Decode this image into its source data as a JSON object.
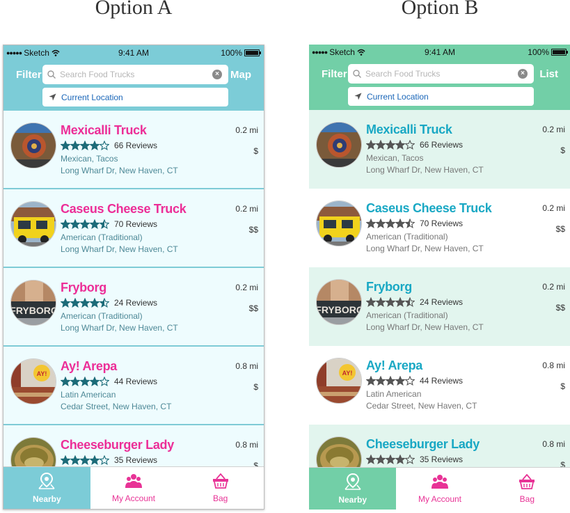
{
  "titles": {
    "a": "Option A",
    "b": "Option B"
  },
  "colors": {
    "a_header": "#7cccd7",
    "a_row_bg": "#eefcfe",
    "a_name": "#ec2e97",
    "a_stars": "#1c6b78",
    "a_subtext": "#4d8896",
    "b_header": "#72cfa7",
    "b_row_bg": "#e2f5ee",
    "b_name": "#19a8c4",
    "b_stars": "#555555",
    "b_subtext": "#777777",
    "tab_accent": "#e83396"
  },
  "status_bar": {
    "carrier": "Sketch",
    "time": "9:41 AM",
    "battery": "100%"
  },
  "header": {
    "filter_label": "Filter",
    "a_right_label": "Map",
    "b_right_label": "List",
    "search_placeholder": "Search Food Trucks",
    "location_label": "Current Location"
  },
  "restaurants": [
    {
      "name": "Mexicalli Truck",
      "stars": 4,
      "reviews": "66 Reviews",
      "category": "Mexican, Tacos",
      "address": "Long Wharf Dr, New Haven, CT",
      "distance": "0.2 mi",
      "price": "$",
      "thumb": "mural"
    },
    {
      "name": "Caseus Cheese Truck",
      "stars": 4.5,
      "reviews": "70 Reviews",
      "category": "American (Traditional)",
      "address": "Long Wharf Dr, New Haven, CT",
      "distance": "0.2 mi",
      "price": "$$",
      "thumb": "yellow-truck"
    },
    {
      "name": "Fryborg",
      "stars": 4.5,
      "reviews": "24 Reviews",
      "category": "American (Traditional)",
      "address": "Long Wharf Dr, New Haven, CT",
      "distance": "0.2 mi",
      "price": "$$",
      "thumb": "fryborg-sign"
    },
    {
      "name": "Ay! Arepa",
      "stars": 4,
      "reviews": "44 Reviews",
      "category": "Latin American",
      "address": "Cedar Street, New Haven, CT",
      "distance": "0.8 mi",
      "price": "$",
      "thumb": "arepa-sign"
    },
    {
      "name": "Cheeseburger Lady",
      "stars": 4,
      "reviews": "35 Reviews",
      "category": "",
      "address": "",
      "distance": "0.8 mi",
      "price": "$",
      "thumb": "burger"
    }
  ],
  "tabs": [
    {
      "label": "Nearby",
      "icon": "map-pin-icon",
      "active": true
    },
    {
      "label": "My Account",
      "icon": "people-icon",
      "active": false
    },
    {
      "label": "Bag",
      "icon": "basket-icon",
      "active": false
    }
  ]
}
